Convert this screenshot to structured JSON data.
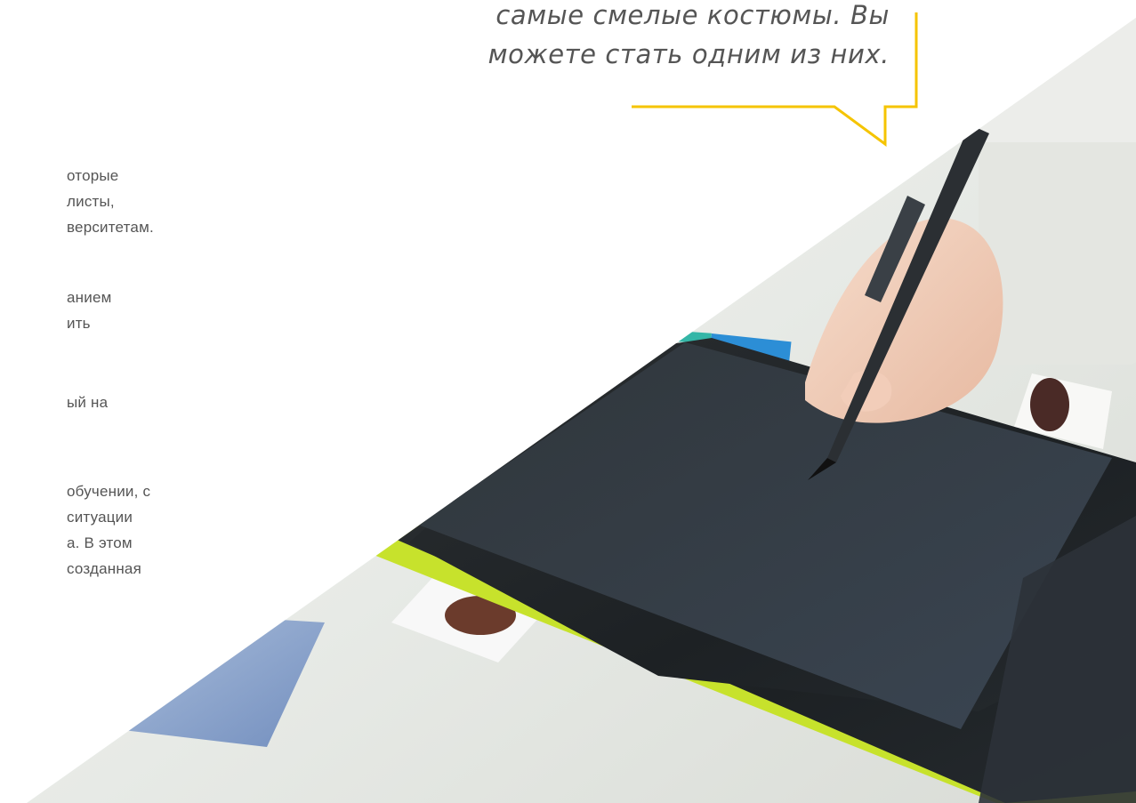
{
  "quote": {
    "lines": [
      "самые смелые костюмы. Вы",
      "можете стать одним из них."
    ]
  },
  "paragraphs": {
    "lines": [
      "оторые",
      "листы,",
      "верситетам.",
      "анием",
      "ить",
      "ый на",
      "обучении, с",
      " ситуации",
      "а. В этом",
      "созданная"
    ]
  },
  "colors": {
    "accent": "#f5c400",
    "text": "#555555",
    "tablet": "#1f2326",
    "tablet_trim": "#c7e22c"
  },
  "image": {
    "description_icon": "photo-hand-with-stylus-on-graphics-tablet"
  }
}
